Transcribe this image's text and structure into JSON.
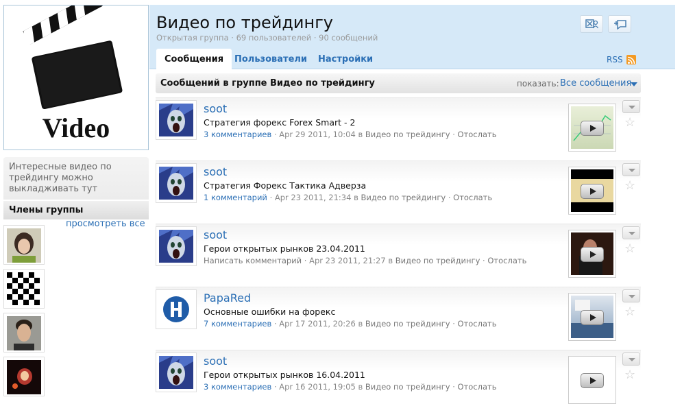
{
  "group": {
    "logo_text": "Video",
    "description": "Интересные видео по трейдингу можно выкладживать тут",
    "members_title": "Члены группы",
    "view_all": "просмотреть все"
  },
  "header": {
    "title": "Видео по трейдингу",
    "subtitle": "Открытая группа · 69 пользователей · 90 сообщений",
    "tabs": [
      "Сообщения",
      "Пользователи",
      "Настройки"
    ],
    "rss": "RSS"
  },
  "toolbar": {
    "title": "Сообщений в группе Видео по трейдингу",
    "show_label": "показать:",
    "show_value": "Все сообщения"
  },
  "posts": [
    {
      "author": "soot",
      "title": "Стратегия форекс Forex Smart - 2",
      "comments": "3 комментариев",
      "date": "Apr 29 2011, 10:04",
      "in": "в",
      "group": "Видео по трейдингу",
      "send": "Отослать"
    },
    {
      "author": "soot",
      "title": "Стратегия Форекс Тактика Адверза",
      "comments": "1 комментарий",
      "date": "Apr 23 2011, 21:34",
      "in": "в",
      "group": "Видео по трейдингу",
      "send": "Отослать"
    },
    {
      "author": "soot",
      "title": "Герои открытых рынков 23.04.2011",
      "comments": "Написать комментарий",
      "date": "Apr 23 2011, 21:27",
      "in": "в",
      "group": "Видео по трейдингу",
      "send": "Отослать"
    },
    {
      "author": "PapaRed",
      "title": "Основные ошибки на форекс",
      "comments": "7 комментариев",
      "date": "Apr 17 2011, 20:26",
      "in": "в",
      "group": "Видео по трейдингу",
      "send": "Отослать"
    },
    {
      "author": "soot",
      "title": "Герои открытых рынков 16.04.2011",
      "comments": "3 комментариев",
      "date": "Apr 16 2011, 19:05",
      "in": "в",
      "group": "Видео по трейдингу",
      "send": "Отослать"
    }
  ],
  "colors": {
    "link": "#2b6fb5",
    "header_bg": "#d6e9f8",
    "rss": "#f39a24"
  },
  "icons": {
    "header_buttons": [
      "leave-group-icon",
      "invite-icon"
    ],
    "post_controls": [
      "chevron-down-icon",
      "star-icon"
    ],
    "thumbnail_overlay": "play-icon"
  }
}
